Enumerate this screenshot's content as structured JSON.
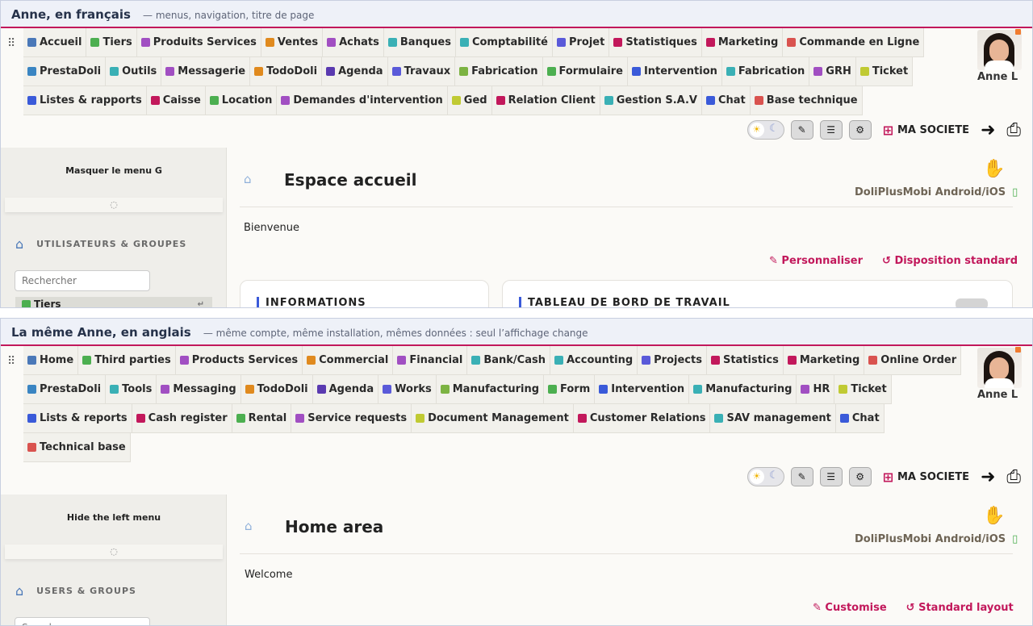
{
  "panels": [
    {
      "title": "Anne, en français",
      "subtitle": "— menus, navigation, titre de page",
      "menu": [
        {
          "label": "Accueil",
          "icon": "home-icon",
          "color": "#4a78b8"
        },
        {
          "label": "Tiers",
          "icon": "building-icon",
          "color": "#4caf50"
        },
        {
          "label": "Produits Services",
          "icon": "cubes-icon",
          "color": "#a14fc2"
        },
        {
          "label": "Ventes",
          "icon": "euro-icon",
          "color": "#e08a1e"
        },
        {
          "label": "Achats",
          "icon": "coins-icon",
          "color": "#a14fc2"
        },
        {
          "label": "Banques",
          "icon": "bank-icon",
          "color": "#3ab0b5"
        },
        {
          "label": "Comptabilité",
          "icon": "scale-icon",
          "color": "#3ab0b5"
        },
        {
          "label": "Projet",
          "icon": "sitemap-icon",
          "color": "#5a5ad9"
        },
        {
          "label": "Statistiques",
          "icon": "chart-icon",
          "color": "#c2185b"
        },
        {
          "label": "Marketing",
          "icon": "bullhorn-icon",
          "color": "#c2185b"
        },
        {
          "label": "Commande en Ligne",
          "icon": "order-icon",
          "color": "#d9534f"
        },
        {
          "label": "PrestaDoli",
          "icon": "sync-icon",
          "color": "#3a85c2"
        },
        {
          "label": "Outils",
          "icon": "tools-icon",
          "color": "#3ab0b5"
        },
        {
          "label": "Messagerie",
          "icon": "mail-icon",
          "color": "#a14fc2"
        },
        {
          "label": "TodoDoli",
          "icon": "calendar-icon",
          "color": "#e08a1e"
        },
        {
          "label": "Agenda",
          "icon": "clock-icon",
          "color": "#5a3ab0"
        },
        {
          "label": "Travaux",
          "icon": "works-icon",
          "color": "#5a5ad9"
        },
        {
          "label": "Fabrication",
          "icon": "factory-icon",
          "color": "#7cb342"
        },
        {
          "label": "Formulaire",
          "icon": "form-icon",
          "color": "#4caf50"
        },
        {
          "label": "Intervention",
          "icon": "wrench-icon",
          "color": "#3a5ad9"
        },
        {
          "label": "Fabrication",
          "icon": "cylinder-icon",
          "color": "#3ab0b5"
        },
        {
          "label": "GRH",
          "icon": "users-icon",
          "color": "#a14fc2"
        },
        {
          "label": "Ticket",
          "icon": "lifebuoy-icon",
          "color": "#c0ca33"
        },
        {
          "label": "Listes & rapports",
          "icon": "table-icon",
          "color": "#3a5ad9"
        },
        {
          "label": "Caisse",
          "icon": "cash-icon",
          "color": "#c2185b"
        },
        {
          "label": "Location",
          "icon": "truck-icon",
          "color": "#4caf50"
        },
        {
          "label": "Demandes d'intervention",
          "icon": "file-icon",
          "color": "#a14fc2"
        },
        {
          "label": "Ged",
          "icon": "folder-icon",
          "color": "#c0ca33"
        },
        {
          "label": "Relation Client",
          "icon": "handshake-icon",
          "color": "#c2185b"
        },
        {
          "label": "Gestion S.A.V",
          "icon": "hands-icon",
          "color": "#3ab0b5"
        },
        {
          "label": "Chat",
          "icon": "chat-icon",
          "color": "#3a5ad9"
        },
        {
          "label": "Base technique",
          "icon": "book-icon",
          "color": "#d9534f"
        }
      ],
      "username": "Anne L",
      "company": "MA SOCIETE",
      "left_menu": {
        "hide": "Masquer le menu G",
        "section": "UTILISATEURS & GROUPES",
        "search_placeholder": "Rechercher",
        "first_item": "Tiers"
      },
      "page": {
        "title": "Espace accueil",
        "mobile": "DoliPlusMobi Android/iOS",
        "welcome": "Bienvenue",
        "customize": "Personnaliser",
        "default_layout": "Disposition standard",
        "box1": "INFORMATIONS",
        "box2": "TABLEAU DE BORD DE TRAVAIL"
      }
    },
    {
      "title": "La même Anne, en anglais",
      "subtitle": "— même compte, même installation, mêmes données : seul l’affichage change",
      "menu": [
        {
          "label": "Home",
          "icon": "home-icon",
          "color": "#4a78b8"
        },
        {
          "label": "Third parties",
          "icon": "building-icon",
          "color": "#4caf50"
        },
        {
          "label": "Products Services",
          "icon": "cubes-icon",
          "color": "#a14fc2"
        },
        {
          "label": "Commercial",
          "icon": "euro-icon",
          "color": "#e08a1e"
        },
        {
          "label": "Financial",
          "icon": "coins-icon",
          "color": "#a14fc2"
        },
        {
          "label": "Bank/Cash",
          "icon": "bank-icon",
          "color": "#3ab0b5"
        },
        {
          "label": "Accounting",
          "icon": "scale-icon",
          "color": "#3ab0b5"
        },
        {
          "label": "Projects",
          "icon": "sitemap-icon",
          "color": "#5a5ad9"
        },
        {
          "label": "Statistics",
          "icon": "chart-icon",
          "color": "#c2185b"
        },
        {
          "label": "Marketing",
          "icon": "bullhorn-icon",
          "color": "#c2185b"
        },
        {
          "label": "Online Order",
          "icon": "order-icon",
          "color": "#d9534f"
        },
        {
          "label": "PrestaDoli",
          "icon": "sync-icon",
          "color": "#3a85c2"
        },
        {
          "label": "Tools",
          "icon": "tools-icon",
          "color": "#3ab0b5"
        },
        {
          "label": "Messaging",
          "icon": "mail-icon",
          "color": "#a14fc2"
        },
        {
          "label": "TodoDoli",
          "icon": "calendar-icon",
          "color": "#e08a1e"
        },
        {
          "label": "Agenda",
          "icon": "clock-icon",
          "color": "#5a3ab0"
        },
        {
          "label": "Works",
          "icon": "works-icon",
          "color": "#5a5ad9"
        },
        {
          "label": "Manufacturing",
          "icon": "factory-icon",
          "color": "#7cb342"
        },
        {
          "label": "Form",
          "icon": "form-icon",
          "color": "#4caf50"
        },
        {
          "label": "Intervention",
          "icon": "wrench-icon",
          "color": "#3a5ad9"
        },
        {
          "label": "Manufacturing",
          "icon": "cylinder-icon",
          "color": "#3ab0b5"
        },
        {
          "label": "HR",
          "icon": "users-icon",
          "color": "#a14fc2"
        },
        {
          "label": "Ticket",
          "icon": "lifebuoy-icon",
          "color": "#c0ca33"
        },
        {
          "label": "Lists & reports",
          "icon": "table-icon",
          "color": "#3a5ad9"
        },
        {
          "label": "Cash register",
          "icon": "cash-icon",
          "color": "#c2185b"
        },
        {
          "label": "Rental",
          "icon": "truck-icon",
          "color": "#4caf50"
        },
        {
          "label": "Service requests",
          "icon": "file-icon",
          "color": "#a14fc2"
        },
        {
          "label": "Document Management",
          "icon": "folder-icon",
          "color": "#c0ca33"
        },
        {
          "label": "Customer Relations",
          "icon": "handshake-icon",
          "color": "#c2185b"
        },
        {
          "label": "SAV management",
          "icon": "hands-icon",
          "color": "#3ab0b5"
        },
        {
          "label": "Chat",
          "icon": "chat-icon",
          "color": "#3a5ad9"
        },
        {
          "label": "Technical base",
          "icon": "book-icon",
          "color": "#d9534f"
        }
      ],
      "username": "Anne L",
      "company": "MA SOCIETE",
      "left_menu": {
        "hide": "Hide the left menu",
        "section": "USERS & GROUPS",
        "search_placeholder": "Search",
        "first_item": ""
      },
      "page": {
        "title": "Home area",
        "mobile": "DoliPlusMobi Android/iOS",
        "welcome": "Welcome",
        "customize": "Customise",
        "default_layout": "Standard layout",
        "box1": "",
        "box2": ""
      }
    }
  ]
}
